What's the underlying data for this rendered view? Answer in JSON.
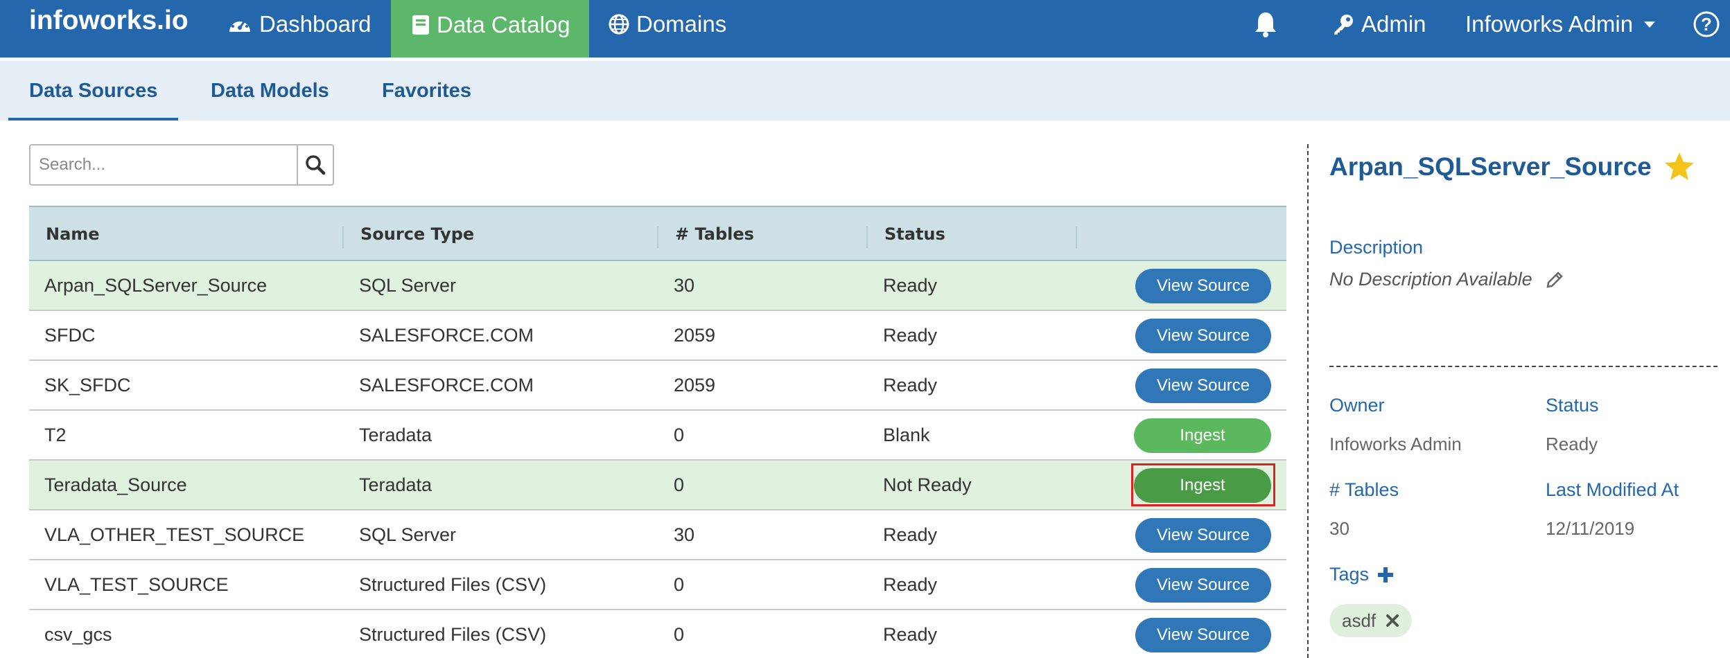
{
  "nav": {
    "logo": "infoworks.io",
    "dashboard": "Dashboard",
    "data_catalog": "Data Catalog",
    "domains": "Domains",
    "admin": "Admin",
    "user": "Infoworks Admin",
    "active_color": "#5cb76a",
    "bar_color": "#2467ac"
  },
  "tabs": {
    "data_sources": "Data Sources",
    "data_models": "Data Models",
    "favorites": "Favorites"
  },
  "search": {
    "placeholder": "Search..."
  },
  "table": {
    "headers": [
      "Name",
      "Source Type",
      "# Tables",
      "Status"
    ],
    "rows": [
      {
        "name": "Arpan_SQLServer_Source",
        "type": "SQL Server",
        "tables": "30",
        "status": "Ready",
        "action": "View Source"
      },
      {
        "name": "SFDC",
        "type": "SALESFORCE.COM",
        "tables": "2059",
        "status": "Ready",
        "action": "View Source"
      },
      {
        "name": "SK_SFDC",
        "type": "SALESFORCE.COM",
        "tables": "2059",
        "status": "Ready",
        "action": "View Source"
      },
      {
        "name": "T2",
        "type": "Teradata",
        "tables": "0",
        "status": "Blank",
        "action": "Ingest"
      },
      {
        "name": "Teradata_Source",
        "type": "Teradata",
        "tables": "0",
        "status": "Not Ready",
        "action": "Ingest"
      },
      {
        "name": "VLA_OTHER_TEST_SOURCE",
        "type": "SQL Server",
        "tables": "30",
        "status": "Ready",
        "action": "View Source"
      },
      {
        "name": "VLA_TEST_SOURCE",
        "type": "Structured Files (CSV)",
        "tables": "0",
        "status": "Ready",
        "action": "View Source"
      },
      {
        "name": "csv_gcs",
        "type": "Structured Files (CSV)",
        "tables": "0",
        "status": "Ready",
        "action": "View Source"
      }
    ]
  },
  "details": {
    "title": "Arpan_SQLServer_Source",
    "description_label": "Description",
    "description": "No Description Available",
    "owner_label": "Owner",
    "owner": "Infoworks Admin",
    "status_label": "Status",
    "status": "Ready",
    "tables_label": "# Tables",
    "tables": "30",
    "modified_label": "Last Modified At",
    "modified": "12/11/2019",
    "tags_label": "Tags",
    "tags": [
      "asdf"
    ]
  }
}
